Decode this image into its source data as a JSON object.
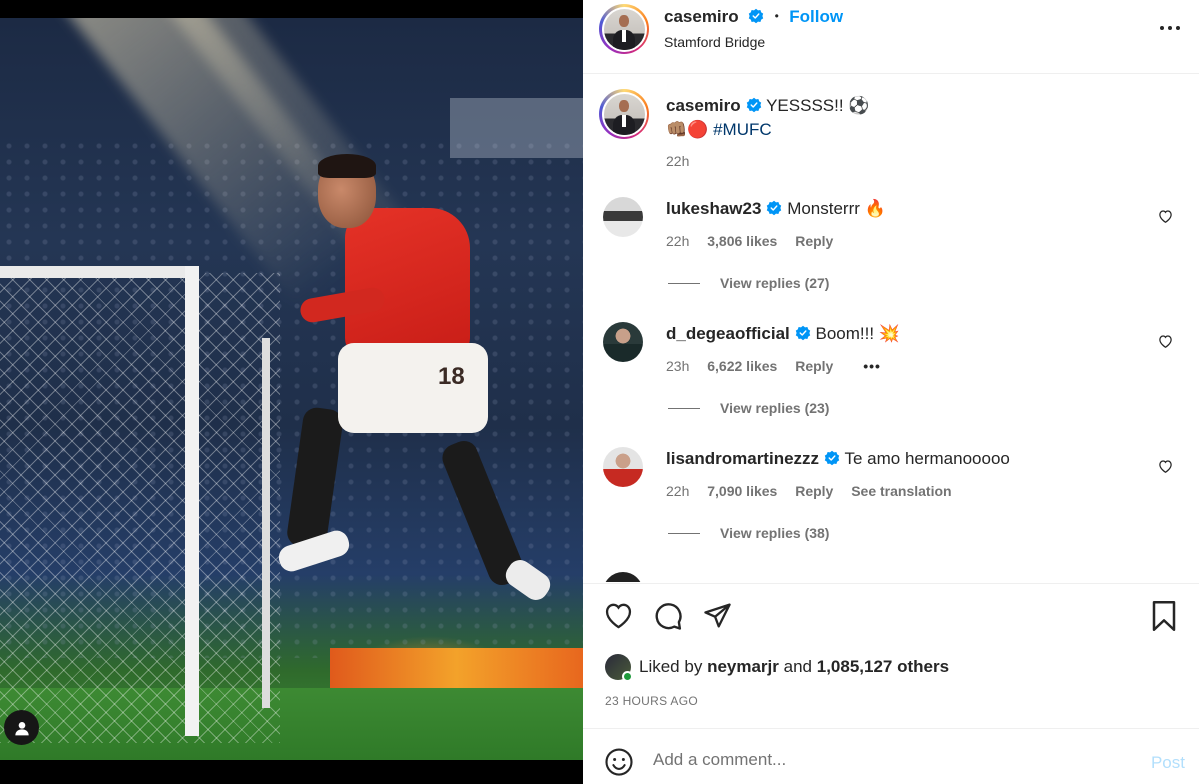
{
  "post": {
    "author": "casemiro",
    "follow_label": "Follow",
    "dot": "•",
    "location": "Stamford Bridge",
    "caption_text": "YESSSS!! ⚽",
    "caption_emoji": "👊🏽🔴",
    "caption_hashtag": "#MUFC",
    "caption_time": "22h",
    "more_icon": "more-horizontal-icon"
  },
  "comments": [
    {
      "user": "lukeshaw23",
      "text": "Monsterrr 🔥",
      "time": "22h",
      "likes": "3,806 likes",
      "reply_label": "Reply",
      "view_replies": "View replies (27)"
    },
    {
      "user": "d_degeaofficial",
      "text": "Boom!!! 💥",
      "time": "23h",
      "likes": "6,622 likes",
      "reply_label": "Reply",
      "options": "•••",
      "view_replies": "View replies (23)"
    },
    {
      "user": "lisandromartinezzz",
      "text": "Te amo hermanooooo",
      "time": "22h",
      "likes": "7,090 likes",
      "reply_label": "Reply",
      "translation": "See translation",
      "view_replies": "View replies (38)"
    }
  ],
  "engagement": {
    "liked_prefix": "Liked by",
    "liked_user": "neymarjr",
    "liked_and": "and",
    "liked_others": "1,085,127 others",
    "timestamp": "23 HOURS AGO"
  },
  "composer": {
    "placeholder": "Add a comment...",
    "post_label": "Post"
  },
  "colors": {
    "accent": "#0095f6",
    "post_disabled": "#b2dffc",
    "secondary_text": "#737373",
    "hashtag": "#00376b"
  }
}
